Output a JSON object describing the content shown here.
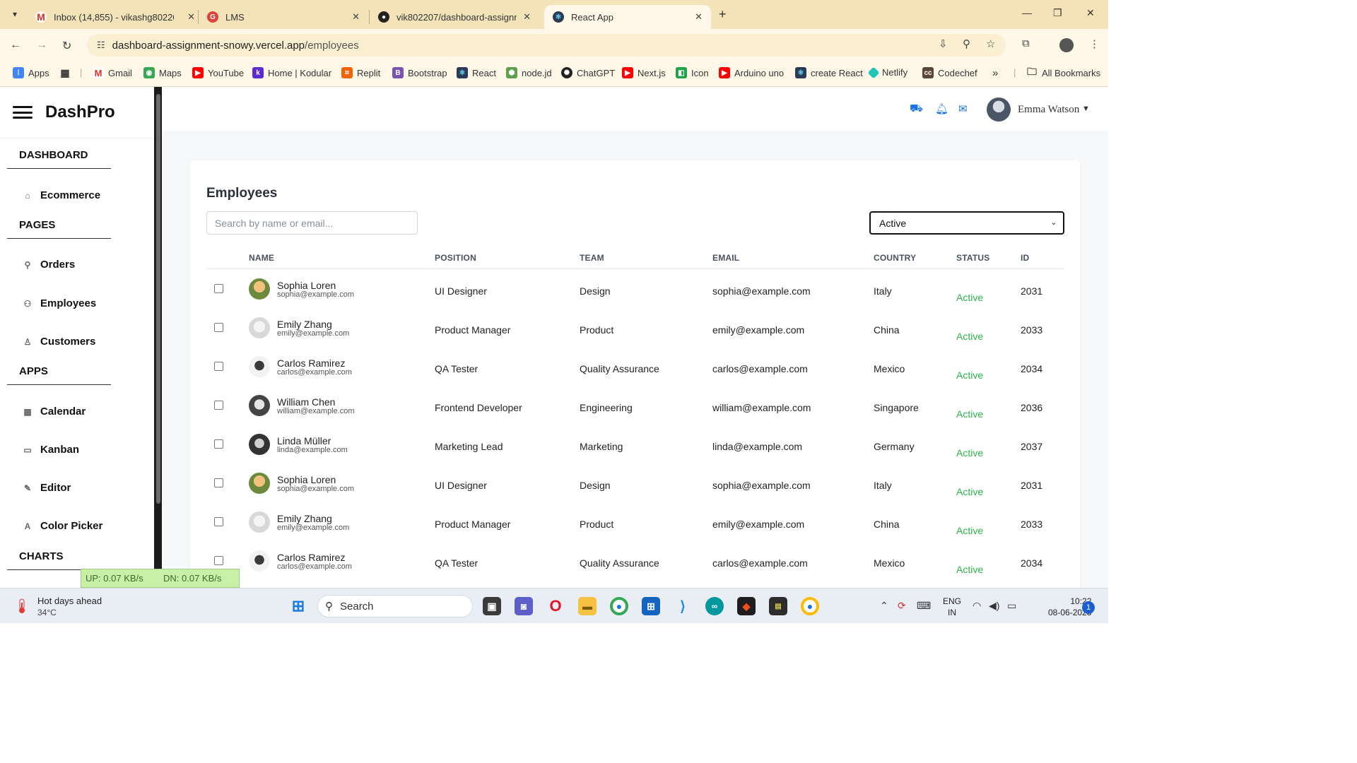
{
  "browser": {
    "tabs": [
      {
        "title": "Inbox (14,855) - vikashg802207",
        "icon": "gmail-icon",
        "color": "#d93025",
        "active": false
      },
      {
        "title": "LMS",
        "icon": "lms-icon",
        "color": "#e0413a",
        "active": false
      },
      {
        "title": "vik802207/dashboard-assignme",
        "icon": "github-icon",
        "color": "#222222",
        "active": false
      },
      {
        "title": "React App",
        "icon": "react-icon",
        "color": "#2b3a55",
        "active": true
      }
    ],
    "url_host": "dashboard-assignment-snowy.vercel.app",
    "url_path": "/employees",
    "bookmarks": [
      "Apps",
      "Gmail",
      "Maps",
      "YouTube",
      "Home | Kodular",
      "Replit",
      "Bootstrap",
      "React",
      "node.jd",
      "ChatGPT",
      "Next.js",
      "Icon",
      "Arduino uno",
      "create React",
      "Netlify",
      "Codechef"
    ],
    "all_bookmarks": "All Bookmarks"
  },
  "sidebar": {
    "brand": "DashPro",
    "sections": [
      {
        "label": "DASHBOARD",
        "items": [
          {
            "label": "Ecommerce",
            "icon": "home-icon"
          }
        ]
      },
      {
        "label": "PAGES",
        "items": [
          {
            "label": "Orders",
            "icon": "pin-icon"
          },
          {
            "label": "Employees",
            "icon": "people-icon"
          },
          {
            "label": "Customers",
            "icon": "person-icon"
          }
        ]
      },
      {
        "label": "APPS",
        "items": [
          {
            "label": "Calendar",
            "icon": "calendar-icon"
          },
          {
            "label": "Kanban",
            "icon": "folder-icon"
          },
          {
            "label": "Editor",
            "icon": "pencil-icon"
          },
          {
            "label": "Color Picker",
            "icon": "text-icon"
          }
        ]
      },
      {
        "label": "CHARTS",
        "items": []
      }
    ]
  },
  "header": {
    "user_name": "Emma Watson"
  },
  "employees": {
    "title": "Employees",
    "search_placeholder": "Search by name or email...",
    "status_filter": "Active",
    "columns": [
      "NAME",
      "POSITION",
      "TEAM",
      "EMAIL",
      "COUNTRY",
      "STATUS",
      "ID"
    ],
    "rows": [
      {
        "name": "Sophia Loren",
        "email": "sophia@example.com",
        "position": "UI Designer",
        "team": "Design",
        "country": "Italy",
        "status": "Active",
        "id": "2031"
      },
      {
        "name": "Emily Zhang",
        "email": "emily@example.com",
        "position": "Product Manager",
        "team": "Product",
        "country": "China",
        "status": "Active",
        "id": "2033"
      },
      {
        "name": "Carlos Ramirez",
        "email": "carlos@example.com",
        "position": "QA Tester",
        "team": "Quality Assurance",
        "country": "Mexico",
        "status": "Active",
        "id": "2034"
      },
      {
        "name": "William Chen",
        "email": "william@example.com",
        "position": "Frontend Developer",
        "team": "Engineering",
        "country": "Singapore",
        "status": "Active",
        "id": "2036"
      },
      {
        "name": "Linda Müller",
        "email": "linda@example.com",
        "position": "Marketing Lead",
        "team": "Marketing",
        "country": "Germany",
        "status": "Active",
        "id": "2037"
      },
      {
        "name": "Sophia Loren",
        "email": "sophia@example.com",
        "position": "UI Designer",
        "team": "Design",
        "country": "Italy",
        "status": "Active",
        "id": "2031"
      },
      {
        "name": "Emily Zhang",
        "email": "emily@example.com",
        "position": "Product Manager",
        "team": "Product",
        "country": "China",
        "status": "Active",
        "id": "2033"
      },
      {
        "name": "Carlos Ramirez",
        "email": "carlos@example.com",
        "position": "QA Tester",
        "team": "Quality Assurance",
        "country": "Mexico",
        "status": "Active",
        "id": "2034"
      }
    ]
  },
  "overlay": {
    "up": "UP: 0.07 KB/s",
    "dn": "DN: 0.07 KB/s"
  },
  "taskbar": {
    "weather_title": "Hot days ahead",
    "weather_temp": "34°C",
    "search": "Search",
    "lang_1": "ENG",
    "lang_2": "IN",
    "time": "10:22",
    "date": "08-06-2025",
    "notifications": "1"
  }
}
